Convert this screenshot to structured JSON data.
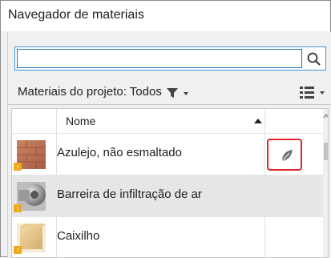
{
  "window": {
    "title": "Navegador de materiais"
  },
  "search": {
    "value": "",
    "placeholder": ""
  },
  "filter": {
    "label": "Materiais do projeto: Todos"
  },
  "table": {
    "column_name": "Nome",
    "rows": [
      {
        "name": "Azulejo, não esmaltado",
        "selected": false,
        "has_leaf": true
      },
      {
        "name": "Barreira de infiltração de ar",
        "selected": true,
        "has_leaf": false
      },
      {
        "name": "Caixilho",
        "selected": false,
        "has_leaf": false
      }
    ]
  },
  "colors": {
    "accent": "#3b95d8",
    "highlight": "#e0262c",
    "selected_row": "#e6e6e6"
  }
}
